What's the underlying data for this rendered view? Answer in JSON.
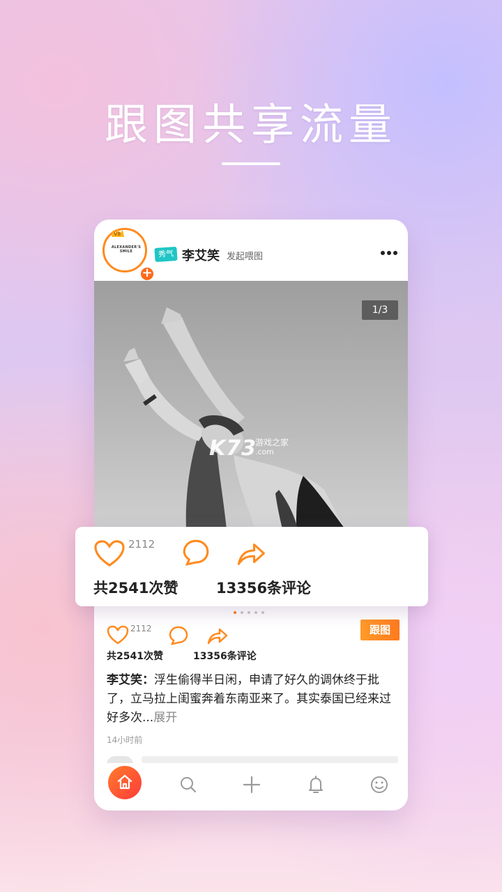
{
  "promo": {
    "headline": "跟图共享流量"
  },
  "post": {
    "avatar_text": "ALEXANDER'S SMILE",
    "vip_badge": "V8",
    "tag_badge": "秀气",
    "username": "李艾笑",
    "action": "发起喂图",
    "more_icon": "more-horizontal-icon",
    "page_counter": "1/3",
    "caption_author": "李艾笑：",
    "caption_text": "浮生偷得半日闲，申请了好久的调休终于批了，立马拉上闺蜜奔着东南亚来了。其实泰国已经来过好多次...",
    "expand_label": "展开",
    "timestamp": "14小时前",
    "follow_label": "跟图"
  },
  "stats": {
    "like_count": "2112",
    "likes_total": "共2541次赞",
    "comments_total": "13356条评论"
  },
  "watermark": {
    "logo": "K73",
    "sub": "游戏之家",
    "domain": ".com"
  },
  "tabs": [
    {
      "icon": "home-icon"
    },
    {
      "icon": "search-icon"
    },
    {
      "icon": "plus-icon"
    },
    {
      "icon": "bell-icon"
    },
    {
      "icon": "smiley-icon"
    }
  ],
  "colors": {
    "accent": "#ff7a1e",
    "accent_gradient_end": "#ff3b3b",
    "tag_teal": "#20c5c5"
  }
}
